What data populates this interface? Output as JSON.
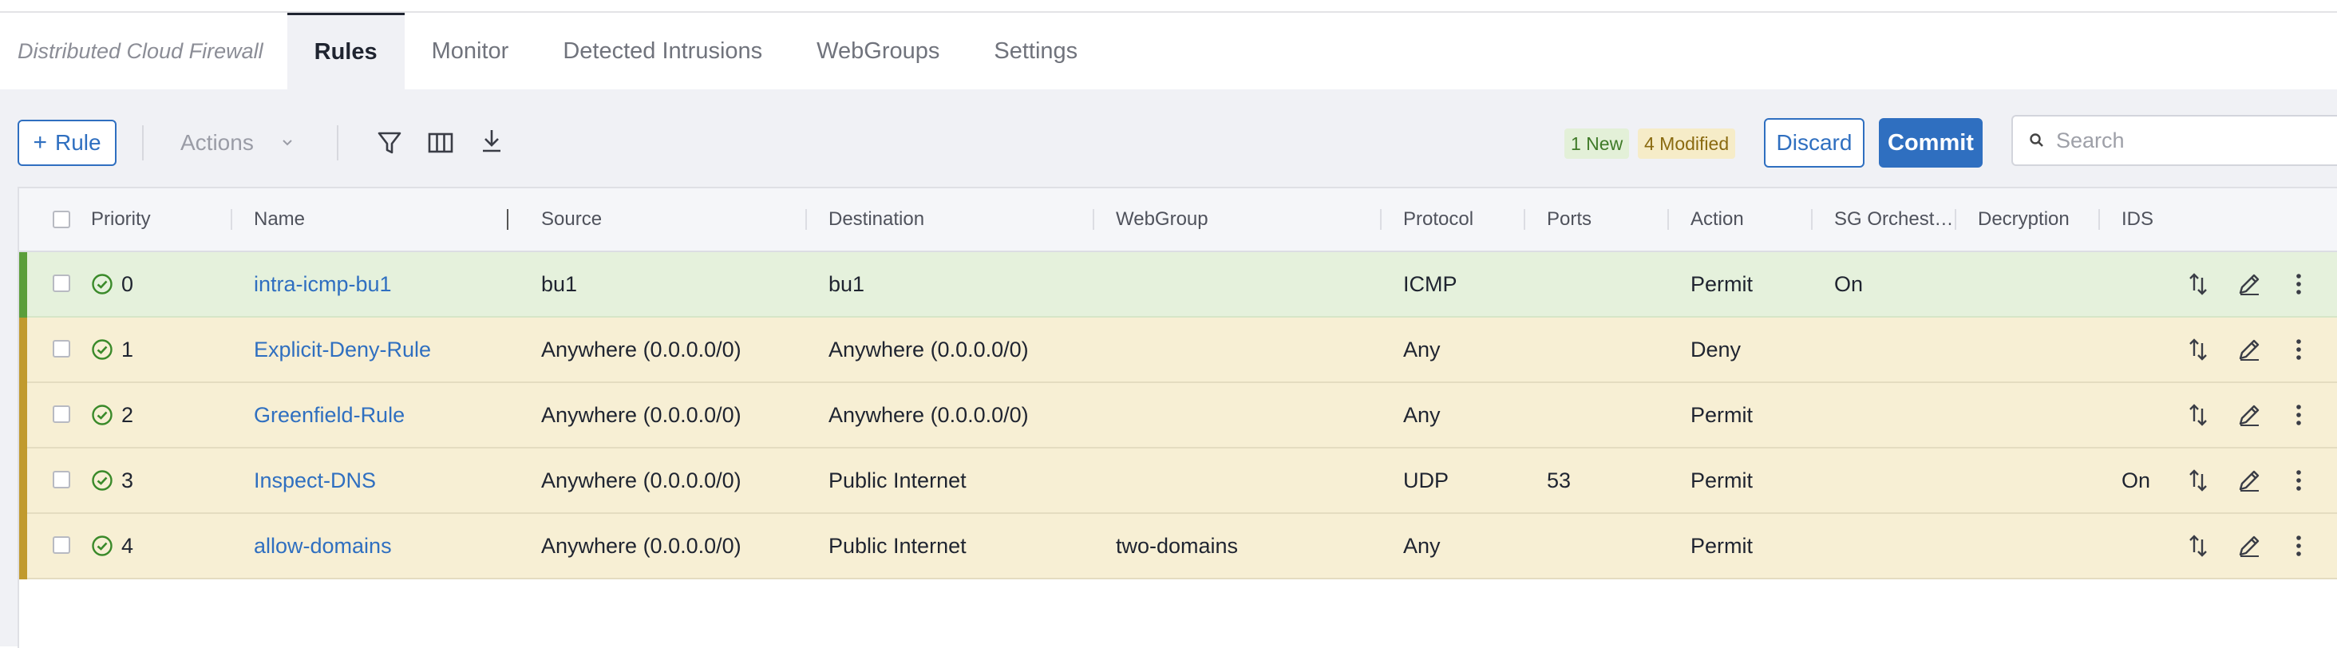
{
  "header": {
    "app_title": "Distributed Cloud Firewall",
    "tabs": [
      {
        "label": "Rules",
        "active": true
      },
      {
        "label": "Monitor"
      },
      {
        "label": "Detected Intrusions"
      },
      {
        "label": "WebGroups"
      },
      {
        "label": "Settings"
      }
    ]
  },
  "toolbar": {
    "add_rule_label": "Rule",
    "add_rule_icon": "plus-icon",
    "actions_label": "Actions",
    "actions_icon": "chevron-down-icon",
    "icons": [
      "filter-icon",
      "columns-icon",
      "download-icon"
    ],
    "new_badge": "1 New",
    "modified_badge": "4 Modified",
    "discard_label": "Discard",
    "commit_label": "Commit",
    "search_placeholder": "Search",
    "search_icon": "search-icon"
  },
  "table": {
    "columns": [
      "Priority",
      "Name",
      "Source",
      "Destination",
      "WebGroup",
      "Protocol",
      "Ports",
      "Action",
      "SG Orchest…",
      "Decryption",
      "IDS"
    ],
    "rows": [
      {
        "priority": "0",
        "name": "intra-icmp-bu1",
        "source": "bu1",
        "destination": "bu1",
        "webgroup": "",
        "protocol": "ICMP",
        "ports": "",
        "action": "Permit",
        "sg_orchestration": "On",
        "decryption": "",
        "ids": "",
        "state": "new"
      },
      {
        "priority": "1",
        "name": "Explicit-Deny-Rule",
        "source": "Anywhere (0.0.0.0/0)",
        "destination": "Anywhere (0.0.0.0/0)",
        "webgroup": "",
        "protocol": "Any",
        "ports": "",
        "action": "Deny",
        "sg_orchestration": "",
        "decryption": "",
        "ids": "",
        "state": "modified"
      },
      {
        "priority": "2",
        "name": "Greenfield-Rule",
        "source": "Anywhere (0.0.0.0/0)",
        "destination": "Anywhere (0.0.0.0/0)",
        "webgroup": "",
        "protocol": "Any",
        "ports": "",
        "action": "Permit",
        "sg_orchestration": "",
        "decryption": "",
        "ids": "",
        "state": "modified"
      },
      {
        "priority": "3",
        "name": "Inspect-DNS",
        "source": "Anywhere (0.0.0.0/0)",
        "destination": "Public Internet",
        "webgroup": "",
        "protocol": "UDP",
        "ports": "53",
        "action": "Permit",
        "sg_orchestration": "",
        "decryption": "",
        "ids": "On",
        "state": "modified"
      },
      {
        "priority": "4",
        "name": "allow-domains",
        "source": "Anywhere (0.0.0.0/0)",
        "destination": "Public Internet",
        "webgroup": "two-domains",
        "protocol": "Any",
        "ports": "",
        "action": "Permit",
        "sg_orchestration": "",
        "decryption": "",
        "ids": "",
        "state": "modified"
      }
    ],
    "row_icons": [
      "status-check-icon",
      "reorder-icon",
      "edit-pencil-icon",
      "more-vertical-icon"
    ]
  },
  "colors": {
    "accent": "#2f6fc0",
    "new_row_bg": "#e5f1dc",
    "new_row_bar": "#5b9e3a",
    "modified_row_bg": "#f7efd4",
    "modified_row_bar": "#c19a2e",
    "new_badge_bg": "#e3f0d8",
    "modified_badge_bg": "#f6ecc8"
  }
}
